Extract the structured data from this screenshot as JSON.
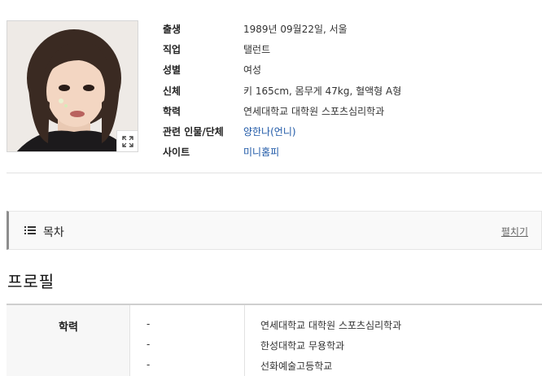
{
  "profile": {
    "photo_icon": "portrait-photo",
    "expand_icon": "expand-icon",
    "rows": [
      {
        "label": "출생",
        "value": "1989년 09월22일, 서울",
        "is_link": false
      },
      {
        "label": "직업",
        "value": "탤런트",
        "is_link": false
      },
      {
        "label": "성별",
        "value": "여성",
        "is_link": false
      },
      {
        "label": "신체",
        "value": "키 165cm, 몸무게 47kg, 혈액형 A형",
        "is_link": false
      },
      {
        "label": "학력",
        "value": "연세대학교 대학원 스포츠심리학과",
        "is_link": false
      },
      {
        "label": "관련 인물/단체",
        "value": "양한나(언니)",
        "is_link": true
      },
      {
        "label": "사이트",
        "value": "미니홈피",
        "is_link": true
      }
    ]
  },
  "toc": {
    "title": "목차",
    "toggle_label": "펼치기",
    "icon": "list-icon"
  },
  "section": {
    "title": "프로필"
  },
  "education": {
    "label": "학력",
    "items": [
      {
        "period": "-",
        "school": "연세대학교 대학원 스포츠심리학과"
      },
      {
        "period": "-",
        "school": "한성대학교 무용학과"
      },
      {
        "period": "-",
        "school": "선화예술고등학교"
      }
    ]
  },
  "colors": {
    "link": "#1d57a6",
    "toc_bar": "#8d8d8d",
    "table_label_bg": "#f7f7f7"
  }
}
